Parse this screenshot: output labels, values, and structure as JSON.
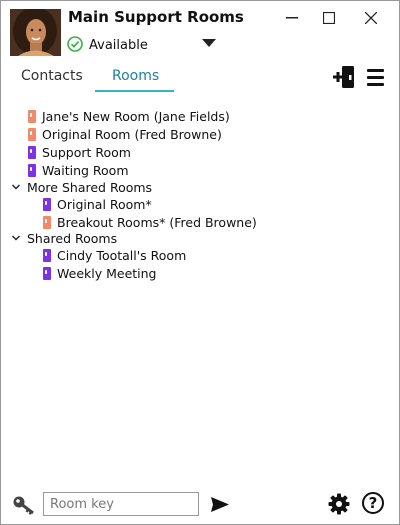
{
  "window": {
    "title": "Main Support Rooms",
    "minimize_glyph": "—",
    "maximize_glyph": "☐",
    "close_glyph": "✕"
  },
  "status": {
    "label": "Available",
    "color": "#3cb043"
  },
  "tabs": [
    {
      "label": "Contacts",
      "active": false
    },
    {
      "label": "Rooms",
      "active": true
    }
  ],
  "colors": {
    "orange_room": "#f08a6a",
    "purple_room": "#7d32e6",
    "accent": "#33b5c4"
  },
  "rooms": [
    {
      "label": "Jane's New Room (Jane Fields)",
      "icon": "room-orange-icon"
    },
    {
      "label": "Original Room (Fred Browne)",
      "icon": "room-orange-icon"
    },
    {
      "label": "Support Room",
      "icon": "room-purple-icon"
    },
    {
      "label": "Waiting Room",
      "icon": "room-purple-icon"
    }
  ],
  "groups": [
    {
      "label": "More Shared Rooms",
      "expanded": true,
      "rooms": [
        {
          "label": "Original Room*",
          "icon": "room-purple-icon"
        },
        {
          "label": "Breakout Rooms* (Fred Browne)",
          "icon": "room-orange-icon"
        }
      ]
    },
    {
      "label": "Shared Rooms",
      "expanded": true,
      "rooms": [
        {
          "label": "Cindy Tootall's Room",
          "icon": "room-purple-icon"
        },
        {
          "label": "Weekly Meeting",
          "icon": "room-purple-icon"
        }
      ]
    }
  ],
  "bottom": {
    "room_key_placeholder": "Room key",
    "help_glyph": "?"
  }
}
